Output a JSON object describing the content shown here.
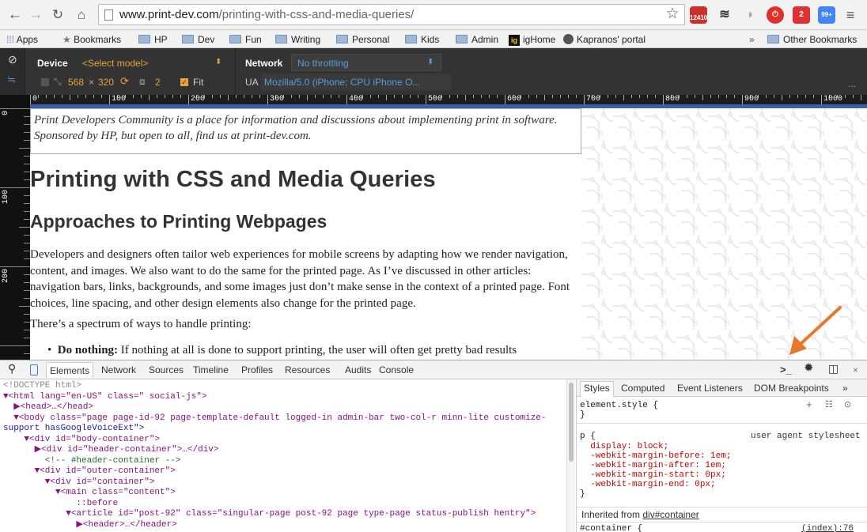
{
  "browser": {
    "url_host": "www.print-dev.com",
    "url_path": "/printing-with-css-and-media-queries/",
    "ext_badge_mail": "12410",
    "ext_badge_red": "2",
    "ext_badge_blue": "99+"
  },
  "bookmarks": {
    "apps": "Apps",
    "items": [
      "Bookmarks",
      "HP",
      "Dev",
      "Fun",
      "Writing",
      "Personal",
      "Kids",
      "Admin",
      "igHome",
      "Kapranos' portal"
    ],
    "more": "»",
    "other": "Other Bookmarks"
  },
  "device_bar": {
    "device_label": "Device",
    "device_value": "<Select model>",
    "network_label": "Network",
    "network_value": "No throttling",
    "width": "568",
    "times": "×",
    "height": "320",
    "dpr": "2",
    "fit_label": "Fit",
    "ua_label": "UA",
    "ua_value": "Mozilla/5.0 (iPhone; CPU iPhone O...",
    "more": "..."
  },
  "ruler": {
    "h_labels": [
      "0",
      "100",
      "200",
      "300",
      "400",
      "500",
      "600",
      "700",
      "800",
      "900",
      "1000"
    ],
    "v_labels": [
      "0",
      "100",
      "200"
    ]
  },
  "page": {
    "intro": "Print Developers Community is a place for information and discussions about implementing print in software. Sponsored by HP, but open to all, find us at print-dev.com.",
    "title": "Printing with CSS and Media Queries",
    "subtitle": "Approaches to Printing Webpages",
    "para1": "Developers and designers often tailor web experiences for mobile screens by adapting how we render navigation, content, and images. We also want to do the same for the printed page. As I’ve discussed in other articles: navigation bars, links, backgrounds, and some images just don’t make sense in the context of a printed page. Font choices, line spacing, and other design elements also change for the printed page.",
    "para2": "There’s a spectrum of ways to handle printing:",
    "bullet_bold": "Do nothing:",
    "bullet_rest": " If nothing at all is done to support printing, the user will often get pretty bad results"
  },
  "devtools": {
    "tabs": [
      "Elements",
      "Network",
      "Sources",
      "Timeline",
      "Profiles",
      "Resources",
      "Audits",
      "Console"
    ],
    "dom_lines": [
      "<!DOCTYPE html>",
      "▼<html lang=\"en-US\" class=\" social-js\">",
      "  ▶<head>…</head>",
      "  ▼<body class=\"page page-id-92 page-template-default logged-in admin-bar two-col-r minn-lite customize-",
      "support hasGoogleVoiceExt\">",
      "    ▼<div id=\"body-container\">",
      "      ▶<div id=\"header-container\">…</div>",
      "        <!-- #header-container -->",
      "      ▼<div id=\"outer-container\">",
      "        ▼<div id=\"container\">",
      "          ▼<main class=\"content\">",
      "              ::before",
      "            ▼<article id=\"post-92\" class=\"singular-page post-92 page type-page status-publish hentry\">",
      "              ▶<header>…</header>"
    ],
    "side_tabs": [
      "Styles",
      "Computed",
      "Event Listeners",
      "DOM Breakpoints",
      "»"
    ],
    "css_lines": [
      "element.style {",
      "}",
      "p {",
      "  display: block;",
      "  -webkit-margin-before: 1em;",
      "  -webkit-margin-after: 1em;",
      "  -webkit-margin-start: 0px;",
      "  -webkit-margin-end: 0px;",
      "}"
    ],
    "ua_stylesheet": "user agent stylesheet",
    "inherited_label": "Inherited from ",
    "inherited_link": "div#container",
    "container_rule": "#container {",
    "index_ref": "(index):76",
    "close": "×"
  },
  "colors": {
    "accent_orange": "#e8a33b",
    "arrow": "#e8782d",
    "ruler_blue": "#3b5fa8"
  }
}
